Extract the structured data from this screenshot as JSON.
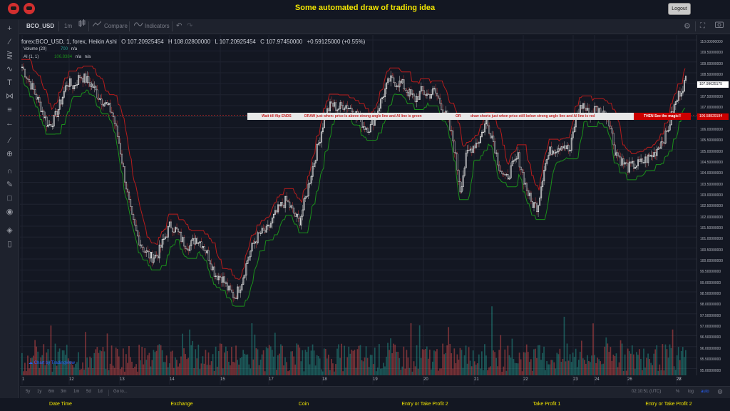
{
  "app": {
    "title": "Some automated draw of trading idea",
    "logout": "Logout"
  },
  "toolbar": {
    "symbol": "BCO_USD",
    "interval": "1m",
    "compare": "Compare",
    "indicators": "Indicators"
  },
  "legend": {
    "main": "forex:BCO_USD, 1, forex, Heikin Ashi",
    "open": "O 107.20925454",
    "high": "H 108.02800000",
    "low": "L 107.20925454",
    "close": "C 107.97450000",
    "change": "+0.59125000 (+0.55%)",
    "volume_label": "Volume (20)",
    "volume_value": "700",
    "volume_na": "n/a",
    "ai_label": "AI (1, 1)",
    "ai_value": "106.8384",
    "ai_na1": "n/a",
    "ai_na2": "n/a"
  },
  "annotation": {
    "part1": "Wait till flip ENDS",
    "part2": "DRAW just when: price is above strong angle line and AI line is green",
    "part3": "OR",
    "part4": "draw shorts just when price still below strong angle line and AI line is red",
    "red_label": "THEN See the magic!!"
  },
  "price_axis": {
    "labels": [
      "110.00000000",
      "109.50000000",
      "109.00000000",
      "108.50000000",
      "108.00000000",
      "107.50000000",
      "107.00000000",
      "106.50000000",
      "106.00000000",
      "105.50000000",
      "105.00000000",
      "104.50000000",
      "104.00000000",
      "103.50000000",
      "103.00000000",
      "102.50000000",
      "102.00000000",
      "101.50000000",
      "101.00000000",
      "100.50000000",
      "100.00000000",
      "99.50000000",
      "99.00000000",
      "98.50000000",
      "98.00000000",
      "97.50000000",
      "97.00000000",
      "96.50000000",
      "96.00000000",
      "95.50000000",
      "95.00000000"
    ],
    "current_price": "107.99625175",
    "line_price": "106.58829194"
  },
  "time_axis": {
    "labels": [
      "1",
      "12",
      "13",
      "14",
      "15",
      "17",
      "18",
      "19",
      "20",
      "21",
      "22",
      "23",
      "24",
      "26",
      "27",
      "28"
    ]
  },
  "bottombar": {
    "ranges": [
      "5y",
      "1y",
      "6m",
      "3m",
      "1m",
      "5d",
      "1d"
    ],
    "goto": "Go to...",
    "time": "02:10:51 (UTC)",
    "percent": "%",
    "log": "log",
    "auto": "auto"
  },
  "watermark": "Chart by TradingView",
  "footer": [
    "Date Time",
    "Exchange",
    "Coin",
    "Entry or Take Profit 2",
    "Take Profit 1",
    "Entry or Take Profit 2"
  ],
  "colors": {
    "up": "#26a69a",
    "down": "#ef5350",
    "green_line": "#1b8f1b",
    "red_line": "#b71c1c",
    "vol_up": "#26a69a",
    "vol_down": "#ef5350"
  },
  "chart_data": {
    "type": "candlestick",
    "ylim": [
      95,
      110
    ],
    "close_series": [
      108.8,
      108.2,
      107.6,
      106.9,
      106.1,
      106.4,
      107.2,
      108.1,
      107.9,
      108.4,
      108.2,
      107.9,
      107.4,
      107.1,
      106.7,
      105.4,
      103.6,
      101.9,
      101.0,
      100.4,
      100.1,
      100.2,
      100.9,
      101.6,
      101.3,
      100.8,
      100.6,
      101.0,
      100.7,
      100.1,
      99.3,
      99.2,
      98.6,
      98.3,
      98.9,
      100.0,
      100.8,
      101.2,
      101.3,
      101.9,
      102.4,
      102.7,
      102.2,
      101.7,
      102.8,
      104.1,
      105.3,
      106.6,
      107.1,
      106.9,
      107.1,
      106.9,
      106.6,
      106.1,
      106.0,
      106.7,
      107.5,
      108.2,
      108.1,
      108.0,
      107.6,
      107.3,
      107.7,
      107.5,
      107.7,
      107.1,
      106.4,
      105.3,
      103.2,
      104.8,
      105.2,
      105.5,
      106.3,
      105.6,
      104.3,
      103.6,
      104.2,
      104.7,
      103.5,
      102.6,
      102.4,
      104.2,
      105.0,
      105.1,
      105.3,
      104.9,
      106.6,
      107.1,
      106.6,
      106.9,
      106.7,
      106.5,
      105.0,
      104.5,
      104.2,
      104.3,
      104.4,
      104.6,
      104.8,
      105.3,
      105.7,
      106.8,
      107.6,
      108.2
    ],
    "volume_note": "volume histogram bars, green/red"
  }
}
